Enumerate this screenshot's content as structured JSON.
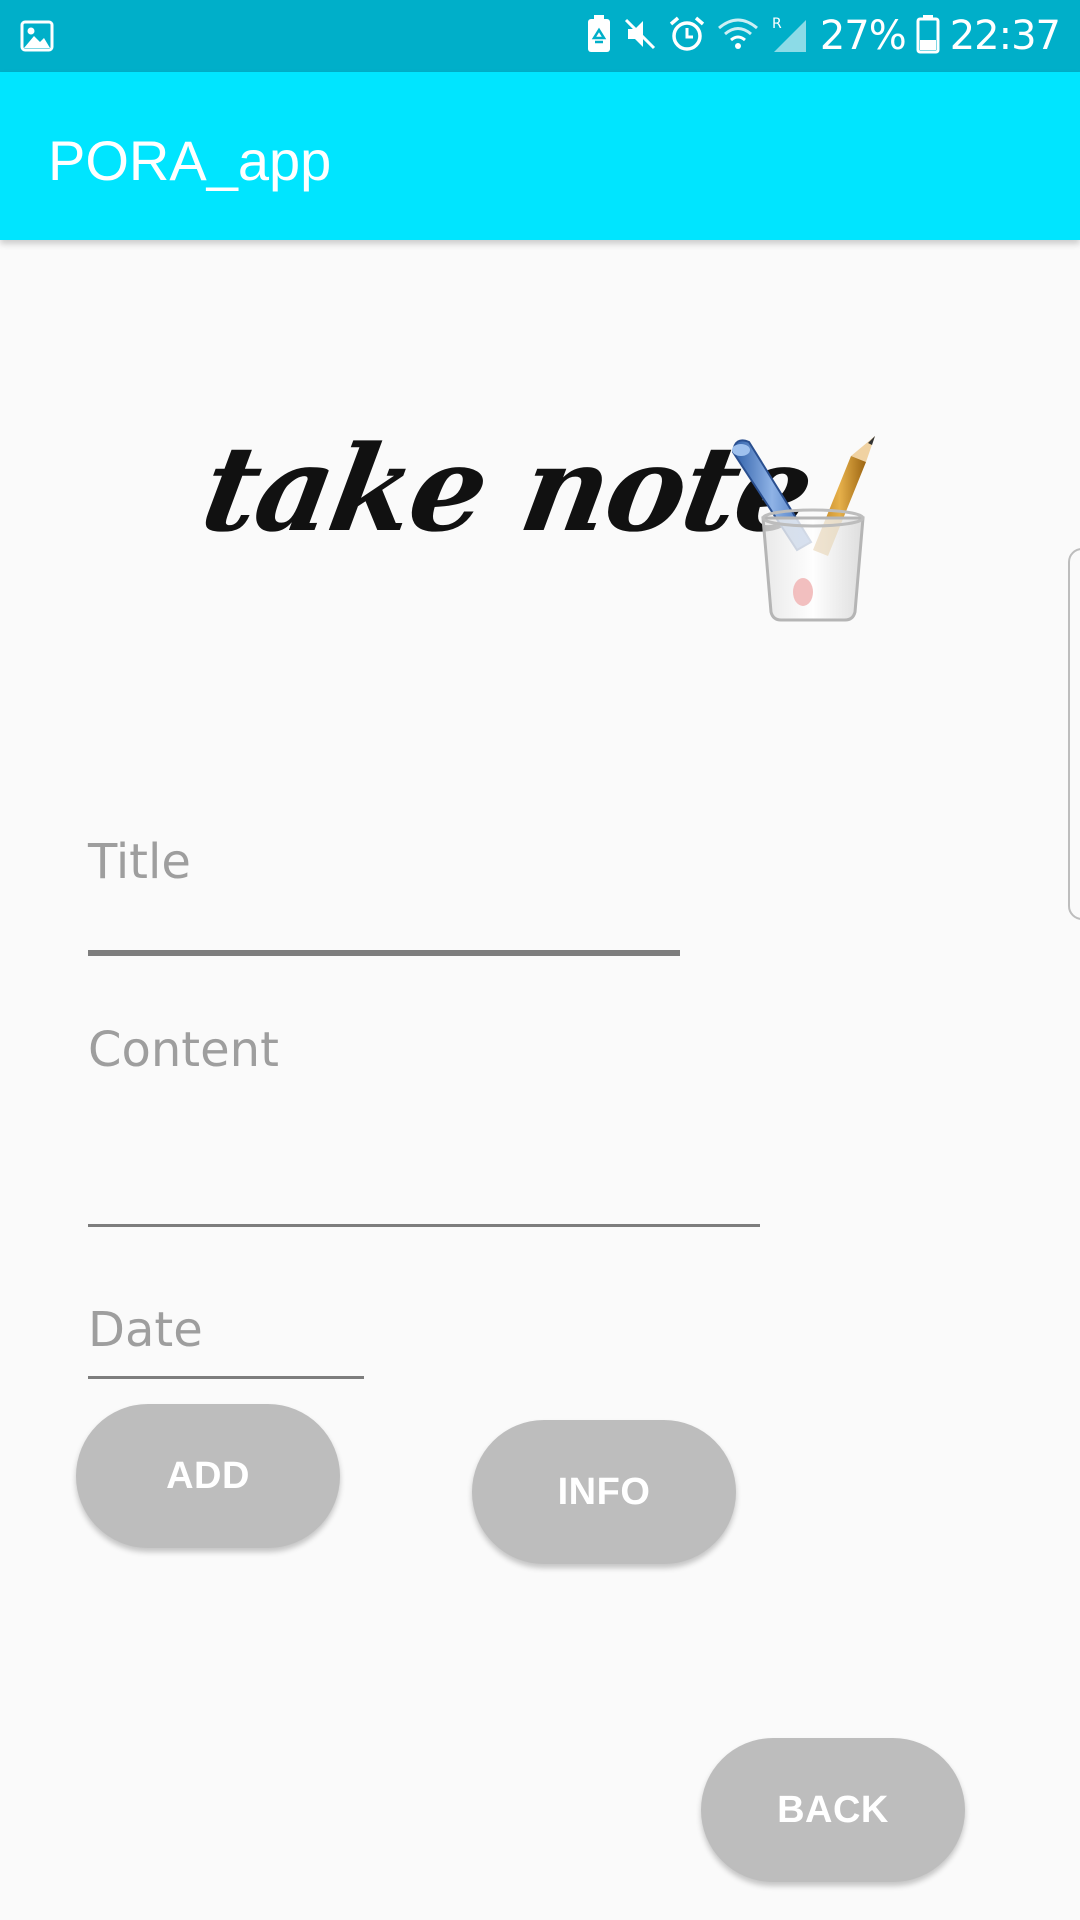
{
  "status_bar": {
    "battery_percent": "27%",
    "time": "22:37",
    "icons": [
      "gallery-icon",
      "battery-saver-icon",
      "mute-icon",
      "alarm-icon",
      "wifi-icon",
      "signal-icon",
      "battery-icon"
    ]
  },
  "app_bar": {
    "title": "PORA_app"
  },
  "hero": {
    "text": "take note"
  },
  "form": {
    "title_placeholder": "Title",
    "content_placeholder": "Content",
    "date_placeholder": "Date"
  },
  "buttons": {
    "add": "ADD",
    "info": "INFO",
    "back": "BACK"
  },
  "colors": {
    "status_bar": "#00afc9",
    "app_bar": "#00e5ff",
    "button": "#bdbdbd",
    "background": "#fafafa"
  }
}
